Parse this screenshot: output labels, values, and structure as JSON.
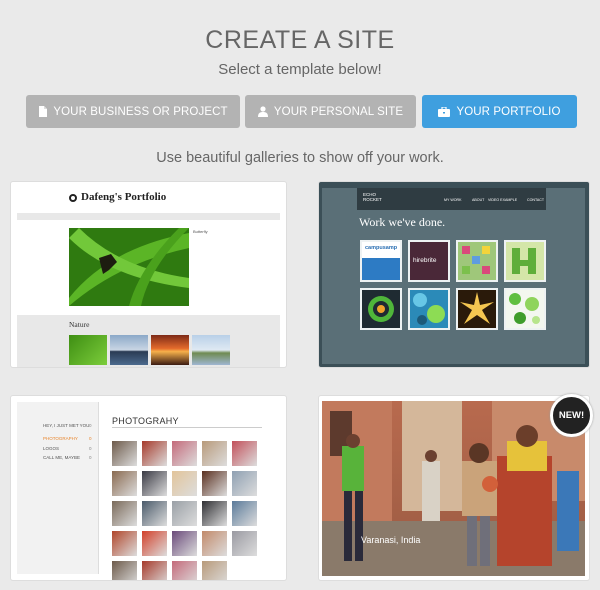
{
  "header": {
    "title": "CREATE A SITE",
    "subtitle": "Select a template below!"
  },
  "tabs": [
    {
      "label": "YOUR BUSINESS OR PROJECT",
      "icon": "document-icon",
      "active": false
    },
    {
      "label": "YOUR PERSONAL SITE",
      "icon": "user-icon",
      "active": false
    },
    {
      "label": "YOUR PORTFOLIO",
      "icon": "briefcase-icon",
      "active": true
    }
  ],
  "colors": {
    "active_tab": "#3f9fdf",
    "inactive_tab": "#b3b3b3",
    "background": "#eaeaea"
  },
  "tagline": "Use beautiful galleries to show off your work.",
  "templates": {
    "dafeng": {
      "site_title": "Dafeng's Portfolio",
      "hero_caption": "Butterfly",
      "section_label": "Nature"
    },
    "echo": {
      "logo": "ECHO ROCKET",
      "nav": [
        "MY WORK",
        "ABOUT",
        "VIDEO EXAMPLE",
        "CONTACT"
      ],
      "heading": "Work we've done.",
      "tiles": [
        "campusamp",
        "hirebrite"
      ]
    },
    "photography": {
      "menu": [
        {
          "label": "HEY, I JUST MET YOU",
          "count": "0"
        },
        {
          "label": "PHOTOGRAPHY",
          "count": "0"
        },
        {
          "label": "LOGOS",
          "count": "0"
        },
        {
          "label": "CALL ME, MAYBE",
          "count": "0"
        }
      ],
      "title": "PHOTOGRAHY"
    },
    "varanasi": {
      "caption": "Varanasi, India",
      "badge": "NEW!"
    }
  }
}
